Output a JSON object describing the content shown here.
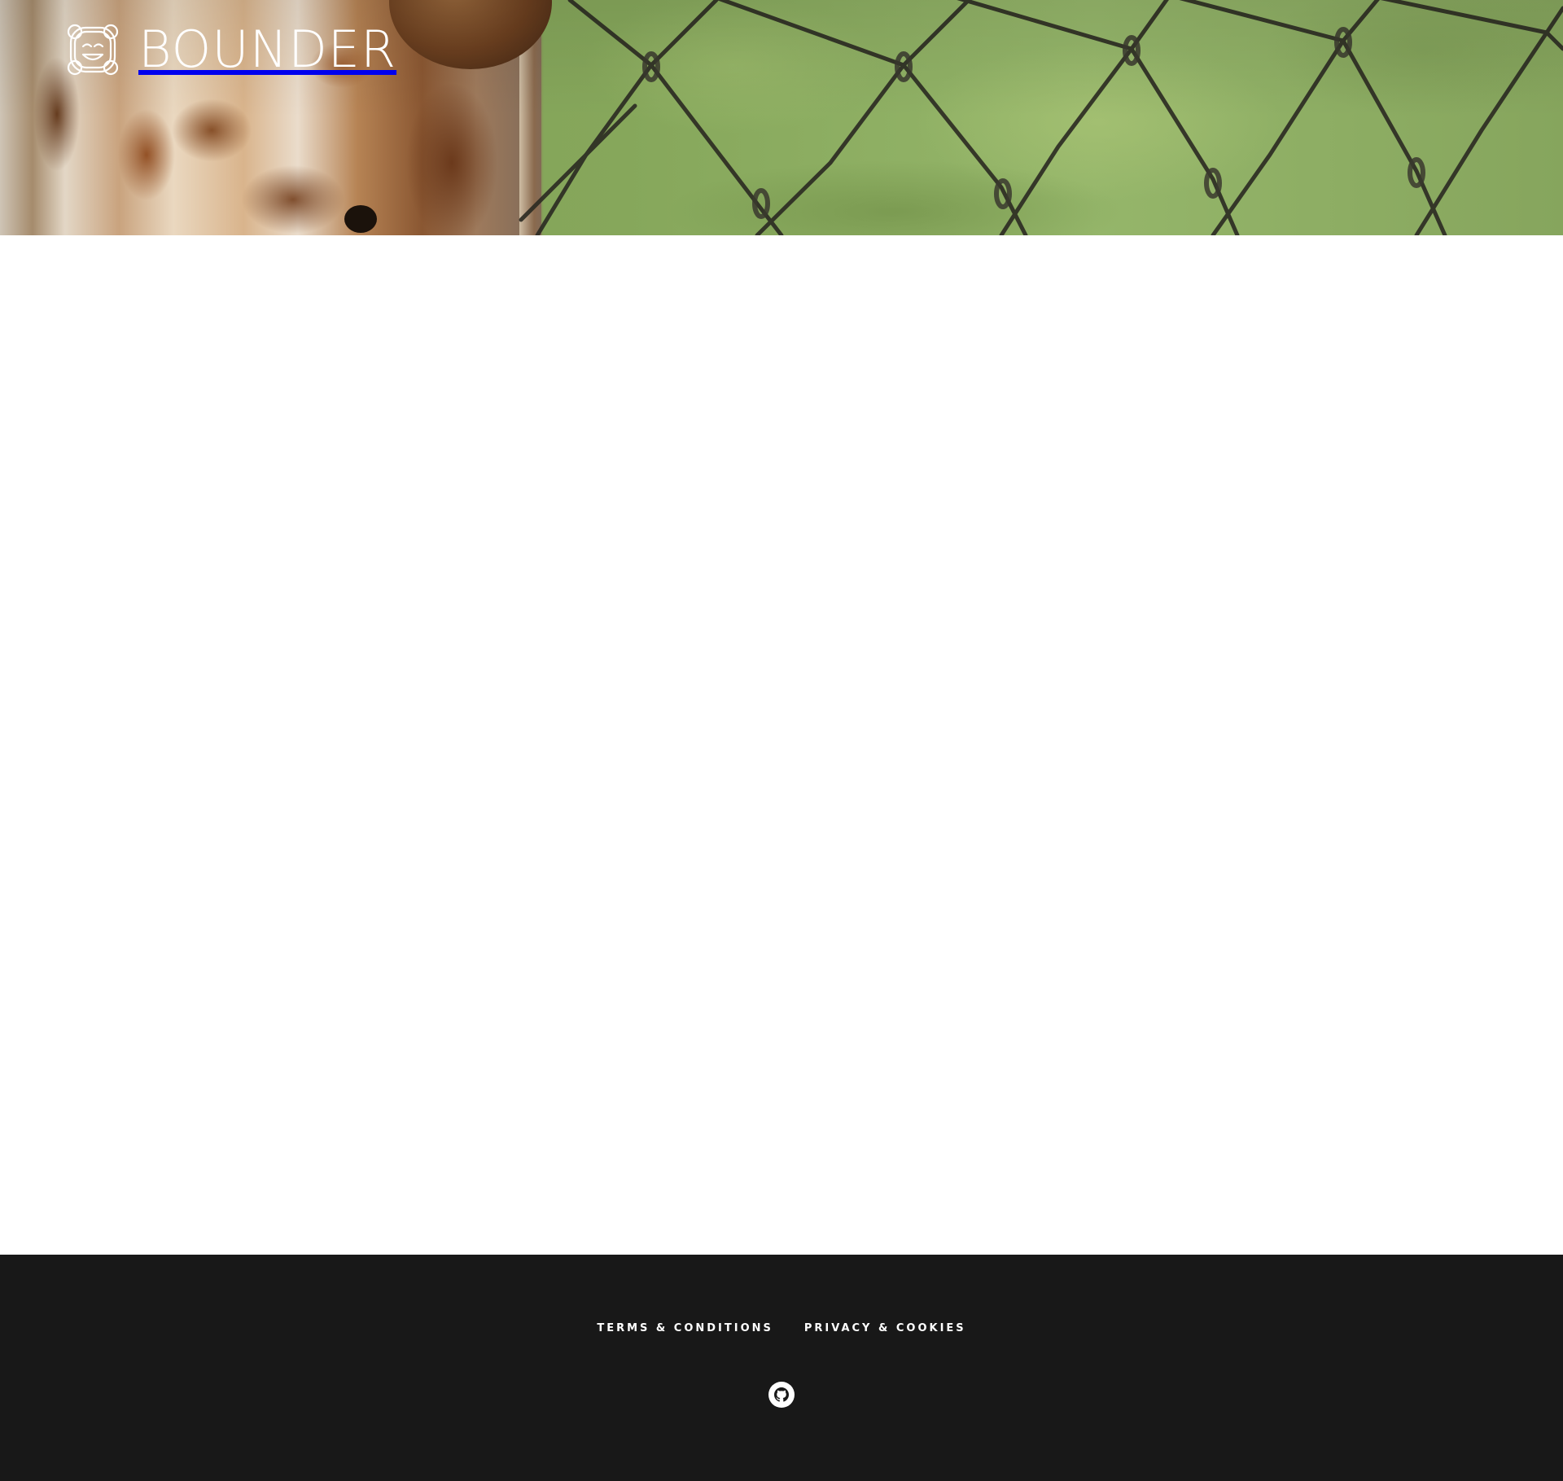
{
  "header": {
    "brand": "BOUNDER",
    "logo_icon": "bounder-mascot-logo"
  },
  "footer": {
    "links": [
      {
        "label": "TERMS & CONDITIONS"
      },
      {
        "label": "PRIVACY & COOKIES"
      }
    ],
    "social_icon": "github-icon",
    "background_color": "#181818"
  },
  "colors": {
    "footer_text": "#ffffff",
    "page_background": "#ffffff"
  }
}
